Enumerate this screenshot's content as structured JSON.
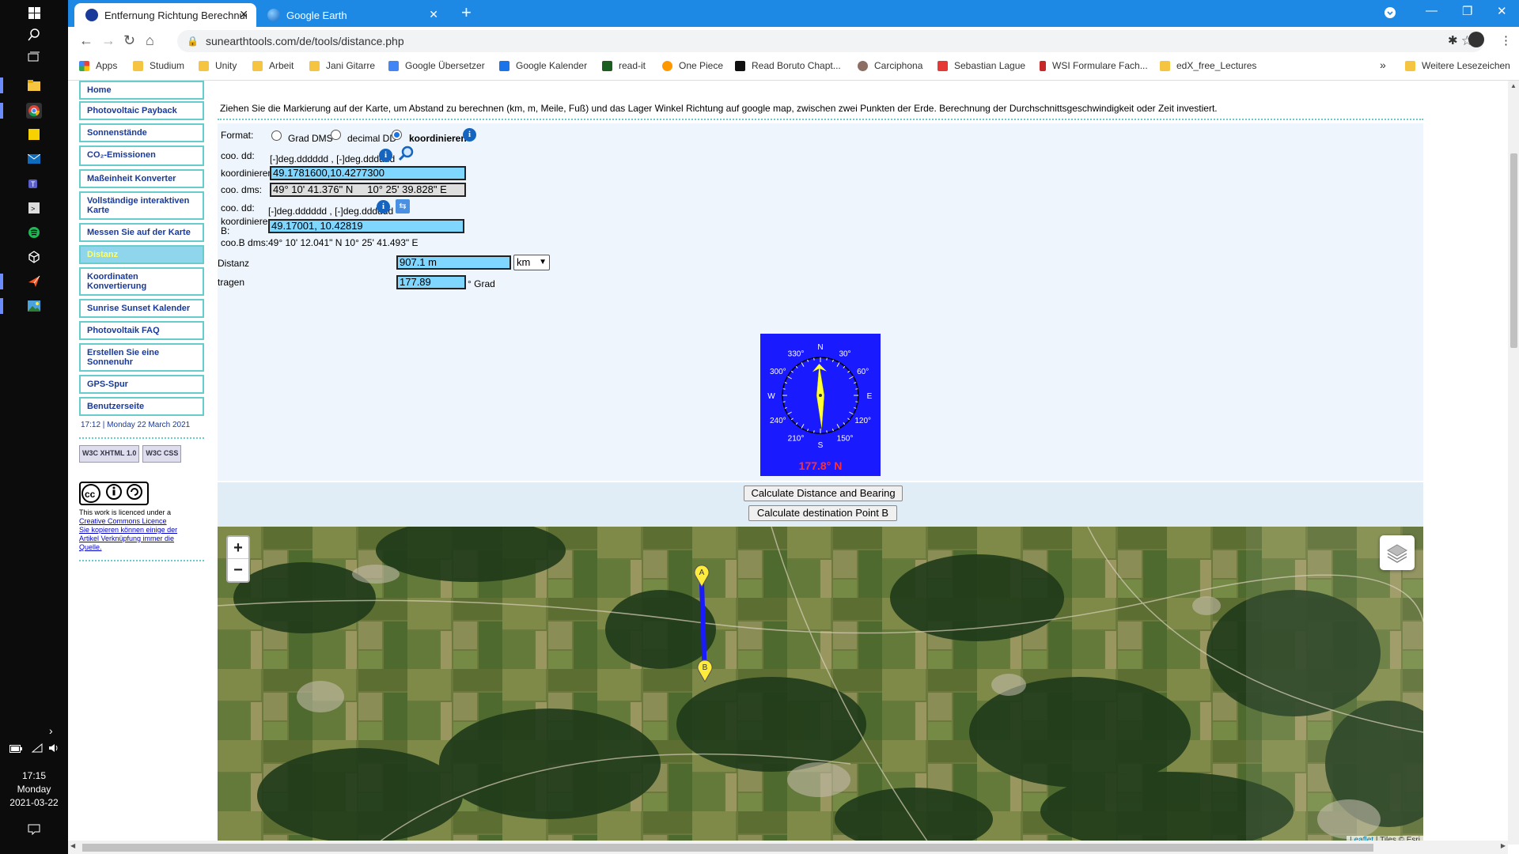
{
  "taskbar": {
    "clock_time": "17:15",
    "clock_day": "Monday",
    "clock_date": "2021-03-22"
  },
  "browser": {
    "tabs": [
      {
        "title": "Entfernung Richtung Berechnung"
      },
      {
        "title": "Google Earth"
      }
    ],
    "url": "sunearthtools.com/de/tools/distance.php",
    "bookmarks": [
      "Apps",
      "Studium",
      "Unity",
      "Arbeit",
      "Jani Gitarre",
      "Google Übersetzer",
      "Google Kalender",
      "read-it",
      "One Piece",
      "Read Boruto Chapt...",
      "Carciphona",
      "Sebastian Lague",
      "WSI Formulare Fach...",
      "edX_free_Lectures"
    ],
    "bookmarks_more": "»",
    "other_bookmarks": "Weitere Lesezeichen"
  },
  "sidebar": {
    "items": [
      {
        "label": "Home"
      },
      {
        "label": "Photovoltaic Payback"
      },
      {
        "label": "Sonnenstände"
      },
      {
        "label": "CO₂-Emissionen"
      },
      {
        "label": "Maßeinheit Konverter"
      },
      {
        "label": "Vollständige interaktiven Karte"
      },
      {
        "label": "Messen Sie auf der Karte"
      },
      {
        "label": "Distanz"
      },
      {
        "label": "Koordinaten Konvertierung"
      },
      {
        "label": "Sunrise Sunset Kalender"
      },
      {
        "label": "Photovoltaik FAQ"
      },
      {
        "label": "Erstellen Sie eine Sonnenuhr"
      },
      {
        "label": "GPS-Spur"
      },
      {
        "label": "Benutzerseite"
      }
    ],
    "datetime": "17:12 | Monday 22 March 2021",
    "badge_xhtml": "W3C XHTML 1.0",
    "badge_css": "W3C CSS",
    "license_prefix": "This work is licenced under a",
    "license_link": "Creative Commons Licence",
    "license_copy": "Sie kopieren können einige der Artikel Verknüpfung immer die Quelle."
  },
  "main": {
    "intro": "Ziehen Sie die Markierung auf der Karte, um Abstand zu berechnen (km, m, Meile, Fuß) und das Lager Winkel Richtung auf google map, zwischen zwei Punkten der Erde. Berechnung der Durchschnittsgeschwindigkeit oder Zeit investiert.",
    "format_label": "Format:",
    "format_options": [
      "Grad DMS",
      "decimal DD",
      "koordinieren"
    ],
    "format_selected": "koordinieren",
    "coo_dd_label": "coo. dd:",
    "coo_dd_hint": "[-]deg.dddddd , [-]deg.dddddd",
    "koordinieren_label": "koordinieren:",
    "koordinieren_a": "49.1781600,10.4277300",
    "coo_dms_label": "coo. dms:",
    "coo_dms_a": "49° 10' 41.376\" N     10° 25' 39.828\" E",
    "coo_dd_b_label": "coo. dd:",
    "coo_dd_b_hint": "[-]deg.dddddd , [-]deg.dddddd",
    "koordinieren_b_label": "koordinieren B:",
    "koordinieren_b": "49.17001, 10.42819",
    "coob_dms_label": "coo.B dms:",
    "coob_dms_value": "49° 10' 12.041\" N 10° 25' 41.493\" E",
    "distanz_label": "Distanz",
    "distanz_value": "907.1 m",
    "unit_selected": "km",
    "tragen_label": "tragen",
    "tragen_value": "177.89",
    "grad_suffix": "° Grad",
    "btn_calc": "Calculate Distance and Bearing",
    "btn_dest": "Calculate destination Point B"
  },
  "compass": {
    "bearing_deg": 177.8,
    "reading": "177.8° N",
    "labels": [
      "N",
      "30°",
      "60°",
      "E",
      "120°",
      "150°",
      "S",
      "210°",
      "240°",
      "W",
      "300°",
      "330°"
    ]
  },
  "map": {
    "zoom_in": "+",
    "zoom_out": "−",
    "marker_a": "A",
    "marker_b": "B",
    "attribution_link": "Leaflet",
    "attribution_text": " | Tiles © Esri",
    "line_color": "#1a1aff"
  }
}
